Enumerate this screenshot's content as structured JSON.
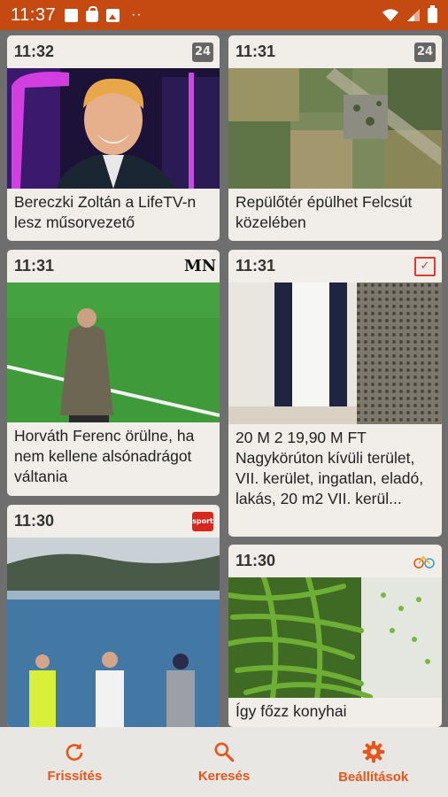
{
  "status_bar": {
    "time": "11:37"
  },
  "cards": [
    {
      "time": "11:32",
      "source_icon": "24",
      "title": "Bereczki Zoltán a LifeTV-n lesz műsorvezető"
    },
    {
      "time": "11:31",
      "source_icon": "24",
      "title": "Repülőtér épülhet Felcsút közelében"
    },
    {
      "time": "11:31",
      "source_icon": "MN",
      "title": "Horváth Ferenc örülne, ha nem kellene alsónadrágot váltania"
    },
    {
      "time": "11:31",
      "source_icon": "news-logo-icon",
      "title": "20 M 2 19,90 M FT Nagykörúton kívüli terület, VII. kerület, ingatlan, eladó, lakás, 20 m2 VII. kerül..."
    },
    {
      "time": "11:30",
      "source_icon": "sport-logo-icon",
      "title": ""
    },
    {
      "time": "11:30",
      "source_icon": "bicycle-icon",
      "title": "Így főzz konyhai"
    }
  ],
  "nav": {
    "refresh_label": "Frissítés",
    "search_label": "Keresés",
    "settings_label": "Beállítások"
  },
  "colors": {
    "status_bar": "#c44a12",
    "accent": "#e8551a",
    "card_bg": "#f1ede9",
    "page_bg": "#6e6e6e"
  }
}
